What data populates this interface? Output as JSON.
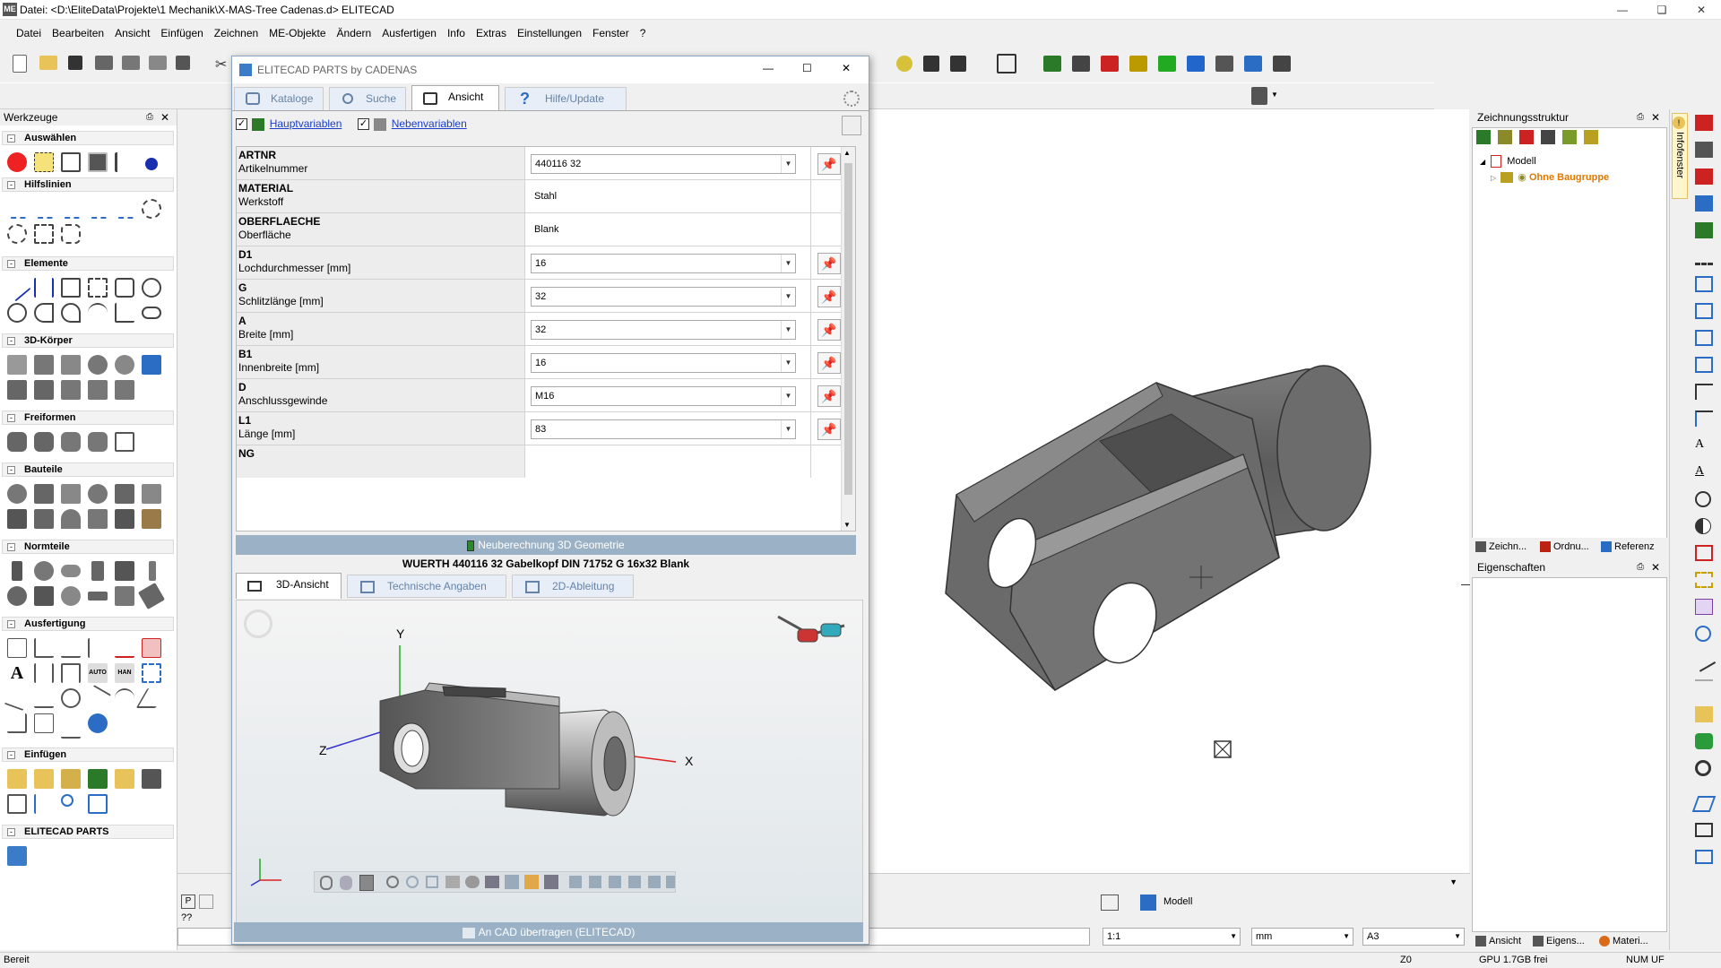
{
  "window": {
    "title": "Datei: <D:\\EliteData\\Projekte\\1 Mechanik\\X-MAS-Tree Cadenas.d>  ELITECAD",
    "app_icon": "ME"
  },
  "menu": [
    "Datei",
    "Bearbeiten",
    "Ansicht",
    "Einfügen",
    "Zeichnen",
    "ME-Objekte",
    "Ändern",
    "Ausfertigen",
    "Info",
    "Extras",
    "Einstellungen",
    "Fenster",
    "?"
  ],
  "werkzeuge": {
    "title": "Werkzeuge",
    "sections": [
      "Auswählen",
      "Hilfslinien",
      "Elemente",
      "3D-Körper",
      "Freiformen",
      "Bauteile",
      "Normteile",
      "Ausfertigung",
      "Einfügen",
      "ELITECAD PARTS"
    ]
  },
  "dialog": {
    "title": "ELITECAD PARTS by CADENAS",
    "tabs": [
      "Kataloge",
      "Suche",
      "Ansicht",
      "Hilfe/Update"
    ],
    "active_tab": "Ansicht",
    "checkbox_main": "Hauptvariablen",
    "checkbox_sub": "Nebenvariablen",
    "rows": [
      {
        "name": "ARTNR",
        "desc": "Artikelnummer",
        "value": "440116 32",
        "editable": true
      },
      {
        "name": "MATERIAL",
        "desc": "Werkstoff",
        "value": "Stahl",
        "editable": false
      },
      {
        "name": "OBERFLAECHE",
        "desc": "Oberfläche",
        "value": "Blank",
        "editable": false
      },
      {
        "name": "D1",
        "desc": "Lochdurchmesser [mm]",
        "value": "16",
        "editable": true
      },
      {
        "name": "G",
        "desc": "Schlitzlänge [mm]",
        "value": "32",
        "editable": true
      },
      {
        "name": "A",
        "desc": "Breite [mm]",
        "value": "32",
        "editable": true
      },
      {
        "name": "B1",
        "desc": "Innenbreite [mm]",
        "value": "16",
        "editable": true
      },
      {
        "name": "D",
        "desc": "Anschlussgewinde",
        "value": "M16",
        "editable": true
      },
      {
        "name": "L1",
        "desc": "Länge [mm]",
        "value": "83",
        "editable": true
      },
      {
        "name": "NG",
        "desc": "",
        "value": "",
        "editable": false
      }
    ],
    "recalc_button": "Neuberechnung 3D Geometrie",
    "part_title": "WUERTH 440116 32 Gabelkopf DIN 71752 G 16x32 Blank",
    "view_tabs": [
      "3D-Ansicht",
      "Technische Angaben",
      "2D-Ableitung"
    ],
    "active_view_tab": "3D-Ansicht",
    "axis_labels": {
      "x": "X",
      "y": "Y",
      "z": "Z"
    },
    "transfer_button": "An CAD übertragen (ELITECAD)"
  },
  "zeichnungsstruktur": {
    "title": "Zeichnungsstruktur",
    "root": "Modell",
    "child": "Ohne Baugruppe",
    "tabs": [
      "Zeichn...",
      "Ordnu...",
      "Referenz"
    ]
  },
  "eigenschaften": {
    "title": "Eigenschaften",
    "tabs": [
      "Ansicht",
      "Eigens...",
      "Materi..."
    ]
  },
  "infofenster": "Infofenster",
  "bottom": {
    "model_tab": "Modell",
    "scale": "1:1",
    "unit": "mm",
    "format": "A3",
    "cmd_prefix": "??"
  },
  "status": {
    "left": "Bereit",
    "coord": "Z0",
    "gpu": "GPU 1.7GB frei",
    "num": "NUM",
    "uf": "UF"
  },
  "colors": {
    "accent": "#2b6cc4",
    "tab_inactive_text": "#6583a8",
    "button_blue": "#9bb1c6",
    "orange_label": "#e07800",
    "part_gray": "#6e6e6e"
  }
}
